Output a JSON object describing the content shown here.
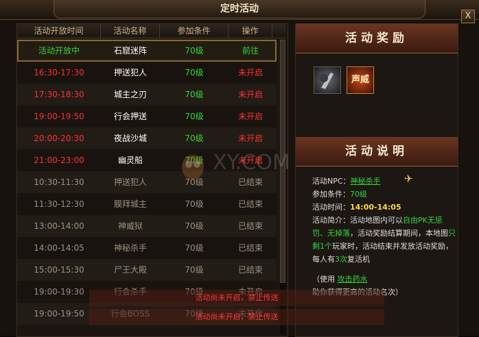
{
  "window": {
    "title": "定时活动",
    "close_label": "X"
  },
  "table": {
    "headers": [
      "活动开放时间",
      "活动名称",
      "参加条件",
      "操作"
    ],
    "rows": [
      {
        "time": "活动开放中",
        "name": "石窟迷阵",
        "cond": "70级",
        "op": "前往",
        "time_color": "#39d339",
        "name_color": "#ffffff",
        "cond_color": "#39d339",
        "op_color": "#39d339"
      },
      {
        "time": "16:30-17:30",
        "name": "押送犯人",
        "cond": "70级",
        "op": "未开启",
        "time_color": "#ff3030",
        "name_color": "#ffffff",
        "cond_color": "#39d339",
        "op_color": "#ff3030"
      },
      {
        "time": "17:30-18:30",
        "name": "城主之刃",
        "cond": "70级",
        "op": "未开启",
        "time_color": "#ff3030",
        "name_color": "#ffffff",
        "cond_color": "#39d339",
        "op_color": "#ff3030"
      },
      {
        "time": "19:00-19:50",
        "name": "行会押送",
        "cond": "70级",
        "op": "未开启",
        "time_color": "#ff3030",
        "name_color": "#ffffff",
        "cond_color": "#39d339",
        "op_color": "#ff3030"
      },
      {
        "time": "20:00-20:30",
        "name": "夜战沙城",
        "cond": "70级",
        "op": "未开启",
        "time_color": "#ff3030",
        "name_color": "#ffffff",
        "cond_color": "#39d339",
        "op_color": "#ff3030"
      },
      {
        "time": "21:00-23:00",
        "name": "幽灵船",
        "cond": "70级",
        "op": "未开启",
        "time_color": "#ff3030",
        "name_color": "#ffffff",
        "cond_color": "#39d339",
        "op_color": "#ff3030"
      },
      {
        "time": "10:30-11:30",
        "name": "押送犯人",
        "cond": "70级",
        "op": "已结束",
        "time_color": "#9c9080",
        "name_color": "#9c9080",
        "cond_color": "#9c9080",
        "op_color": "#9c9080"
      },
      {
        "time": "11:30-12:30",
        "name": "膜拜城主",
        "cond": "70级",
        "op": "已结束",
        "time_color": "#9c9080",
        "name_color": "#9c9080",
        "cond_color": "#9c9080",
        "op_color": "#9c9080"
      },
      {
        "time": "13:00-14:00",
        "name": "神威狱",
        "cond": "70级",
        "op": "已结束",
        "time_color": "#9c9080",
        "name_color": "#9c9080",
        "cond_color": "#9c9080",
        "op_color": "#9c9080"
      },
      {
        "time": "14:00-14:05",
        "name": "神秘杀手",
        "cond": "70级",
        "op": "已结束",
        "time_color": "#9c9080",
        "name_color": "#9c9080",
        "cond_color": "#9c9080",
        "op_color": "#9c9080"
      },
      {
        "time": "15:00-15:30",
        "name": "尸王大殿",
        "cond": "70级",
        "op": "已结束",
        "time_color": "#9c9080",
        "name_color": "#9c9080",
        "cond_color": "#9c9080",
        "op_color": "#9c9080"
      },
      {
        "time": "19:00-19:30",
        "name": "行会杀手",
        "cond": "70级",
        "op": "未开启",
        "time_color": "#9c9080",
        "name_color": "#9c9080",
        "cond_color": "#9c9080",
        "op_color": "#9c9080"
      },
      {
        "time": "19:00-19:50",
        "name": "行会BOSS",
        "cond": "70级",
        "op": "未开启",
        "time_color": "#9c9080",
        "name_color": "#9c9080",
        "cond_color": "#9c9080",
        "op_color": "#9c9080"
      }
    ]
  },
  "rewards": {
    "title": "活动奖励",
    "items": [
      "sword-warrior-icon",
      "prestige-icon"
    ],
    "badge_text": "声威"
  },
  "description": {
    "title": "活动说明",
    "npc_label": "活动NPC：",
    "npc_value": "神秘杀手",
    "cond_label": "参加条件：",
    "cond_value": "70级",
    "time_label": "活动时间：",
    "time_value": "14:00-14:05",
    "intro_label": "活动简介：",
    "intro_a": "活动地图内可以",
    "intro_b": "自由PK无惩罚、无掉落",
    "intro_c": "，活动奖励结算期间，本地图",
    "intro_d": "只剩1个",
    "intro_e": "玩家时，活动结束并发放活动奖励，每人有",
    "intro_f": "3次",
    "intro_g": "复活机",
    "tip_a": "（使用 ",
    "tip_link": "攻击药水",
    "tip_b": "助你获得更高的活动名次）"
  },
  "notice": {
    "text1": "活动尚未开启，禁止传送",
    "text2": "活动尚未开启，禁止传送"
  },
  "watermark": "XY.COM",
  "colors": {
    "accent": "#c89a52",
    "green": "#39d339",
    "red": "#ff3030",
    "yellow": "#ffdd33"
  }
}
